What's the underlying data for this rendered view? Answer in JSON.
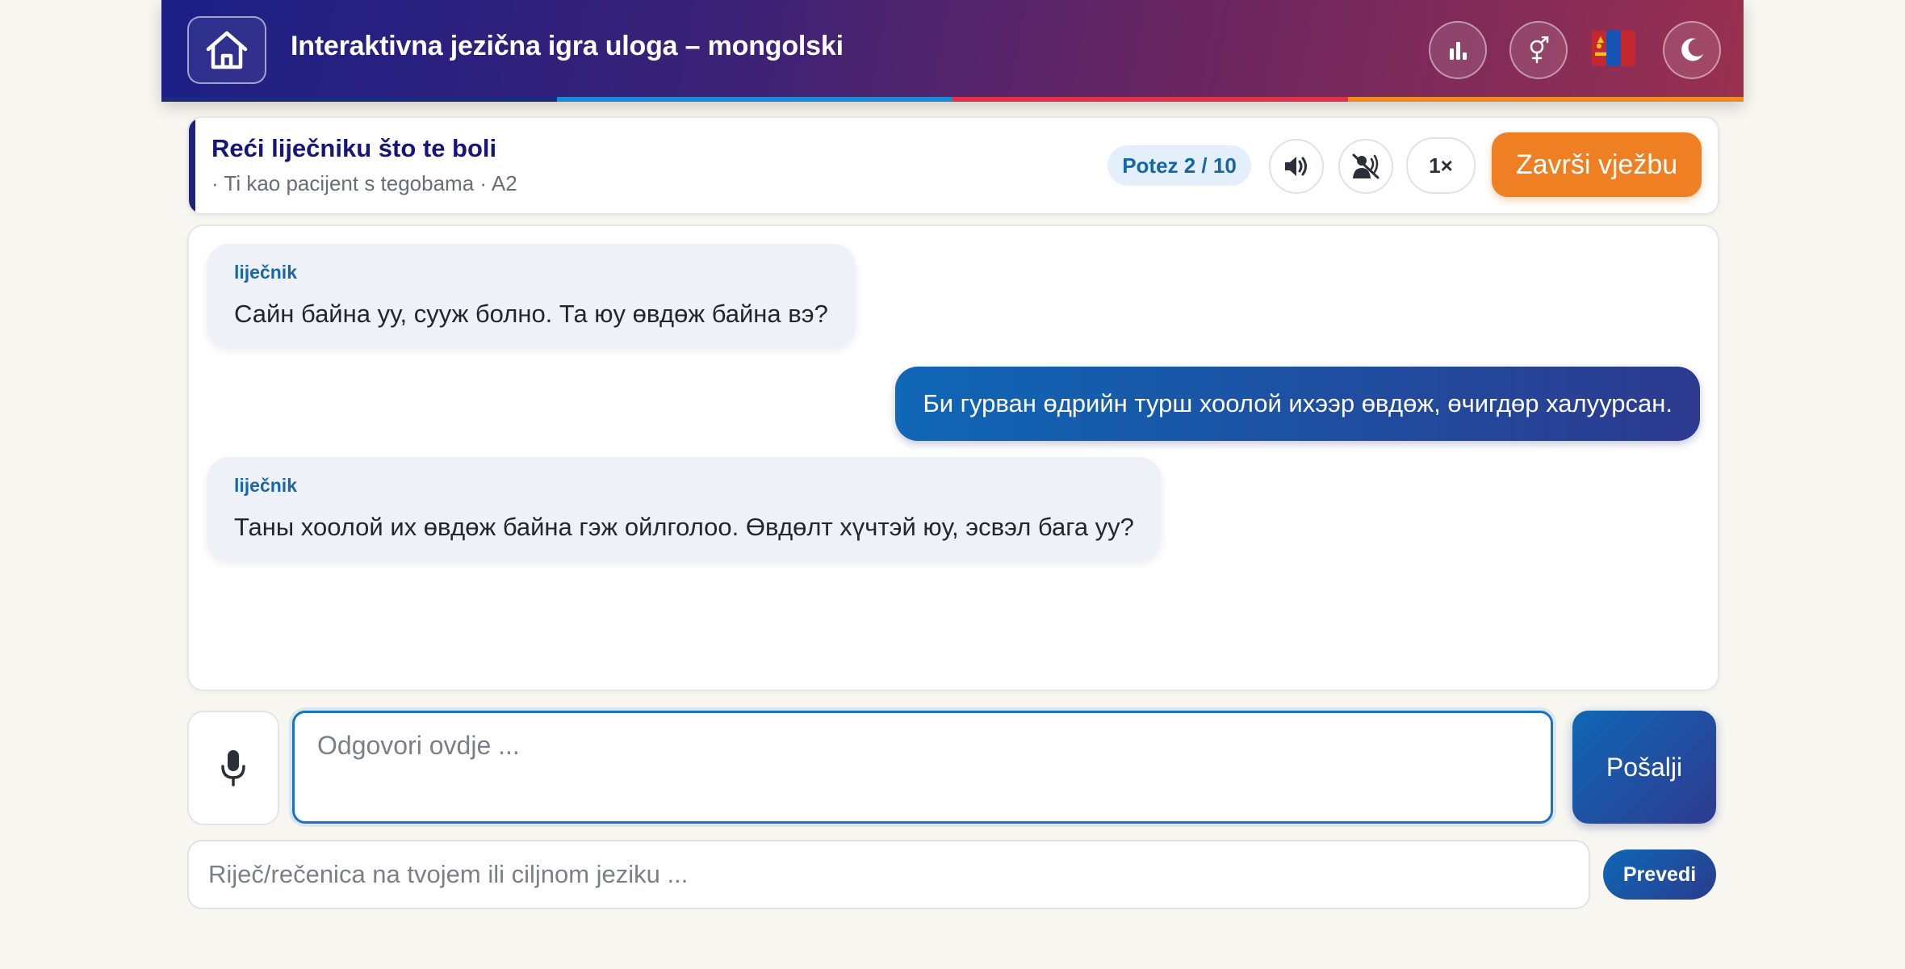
{
  "header": {
    "title": "Interaktivna jezična igra uloga – mongolski",
    "home_icon": "home-icon",
    "stats_icon": "bar-chart-icon",
    "gender_icon": "gender-icon",
    "flag_icon": "mongolia-flag-icon",
    "theme_icon": "moon-icon",
    "stripe_colors": [
      "#1b2a7a",
      "#1e88d6",
      "#e0304a",
      "#f08a24"
    ]
  },
  "scenario": {
    "title": "Reći liječniku što te boli",
    "subtitle": "· Ti kao pacijent s tegobama · A2",
    "turn_label": "Potez 2 / 10",
    "speaker_icon": "speaker-icon",
    "auto_voice_off_icon": "voice-off-icon",
    "speed_label": "1×",
    "finish_label": "Završi vježbu"
  },
  "chat": {
    "messages": [
      {
        "role": "npc",
        "speaker": "liječnik",
        "text": "Сайн байна уу, сууж болно. Та юу өвдөж байна вэ?"
      },
      {
        "role": "user",
        "text": "Би гурван өдрийн турш хоолой ихээр өвдөж, өчигдөр халуурсан."
      },
      {
        "role": "npc",
        "speaker": "liječnik",
        "text": "Таны хоолой их өвдөж байна гэж ойлголоо. Өвдөлт хүчтэй юу, эсвэл бага уу?"
      }
    ]
  },
  "input": {
    "mic_icon": "microphone-icon",
    "reply_placeholder": "Odgovori ovdje ...",
    "send_label": "Pošalji",
    "translate_placeholder": "Riječ/rečenica na tvojem ili ciljnom jeziku ...",
    "translate_label": "Prevedi"
  },
  "colors": {
    "accent_blue": "#1a72c2",
    "finish_orange": "#ee7f22",
    "title_navy": "#16157a"
  }
}
